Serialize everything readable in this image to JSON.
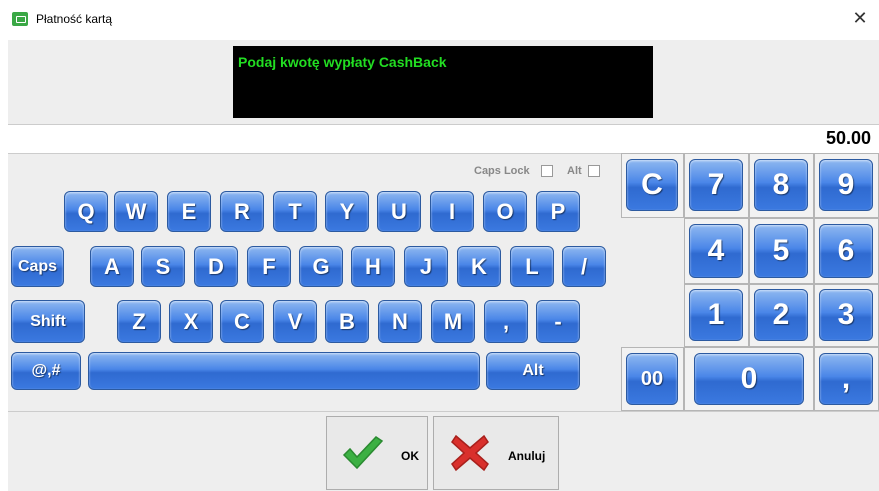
{
  "window": {
    "title": "Płatność kartą",
    "close_glyph": "✕",
    "icon": "card-payment-icon"
  },
  "prompt": {
    "text": "Podaj kwotę wypłaty CashBack",
    "text_color": "#22dd22",
    "bg_color": "#000000"
  },
  "amount": {
    "value": "50.00"
  },
  "options": {
    "caps_lock_label": "Caps Lock",
    "alt_label": "Alt"
  },
  "keyboard": {
    "row1": [
      "Q",
      "W",
      "E",
      "R",
      "T",
      "Y",
      "U",
      "I",
      "O",
      "P"
    ],
    "row2": [
      "A",
      "S",
      "D",
      "F",
      "G",
      "H",
      "J",
      "K",
      "L",
      "/"
    ],
    "row2_caps": "Caps",
    "row3": [
      "Z",
      "X",
      "C",
      "V",
      "B",
      "N",
      "M",
      ",",
      "-"
    ],
    "row3_shift": "Shift",
    "row4_symbols": "@,#",
    "row4_alt": "Alt"
  },
  "numpad": {
    "clear": "C",
    "digits": [
      "7",
      "8",
      "9",
      "4",
      "5",
      "6",
      "1",
      "2",
      "3"
    ],
    "double_zero": "00",
    "zero": "0",
    "comma": ","
  },
  "buttons": {
    "ok_label": "OK",
    "cancel_label": "Anuluj"
  },
  "colors": {
    "key_blue": "#3b79e0",
    "ok_green": "#3cb043",
    "cancel_red": "#d9302c"
  }
}
